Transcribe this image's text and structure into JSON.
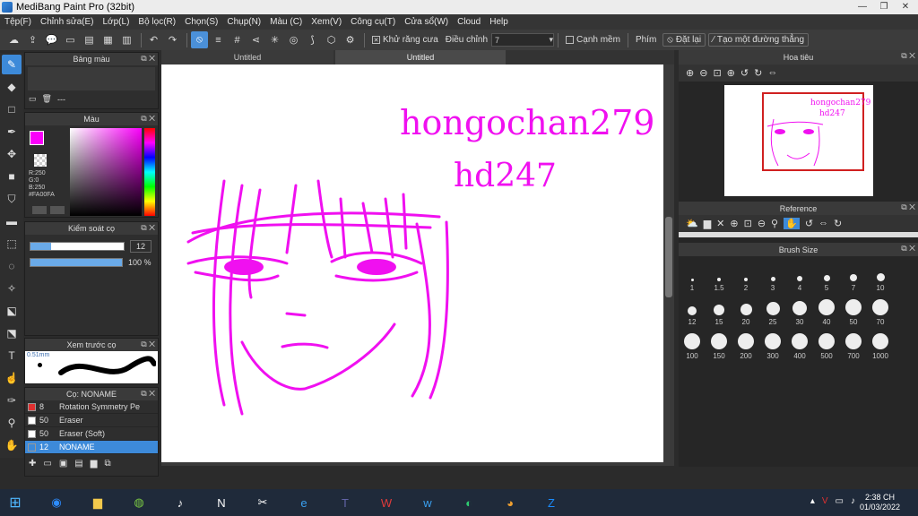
{
  "app": {
    "title": "MediBang Paint Pro (32bit)"
  },
  "menu": [
    "Tệp(F)",
    "Chỉnh sửa(E)",
    "Lớp(L)",
    "Bộ lọc(R)",
    "Chọn(S)",
    "Chụp(N)",
    "Màu (C)",
    "Xem(V)",
    "Công cụ(T)",
    "Cửa sổ(W)",
    "Cloud",
    "Help"
  ],
  "toolbar": {
    "antialias": "Khử răng cưa",
    "correction_label": "Điều chỉnh",
    "correction_value": "7",
    "edge": "Cạnh mềm",
    "key_label": "Phím",
    "reset": "Đặt lại",
    "straight": "Tạo một đường thẳng"
  },
  "tabs": [
    "Untitled",
    "Untitled"
  ],
  "panels": {
    "palette": "Bảng màu",
    "palette_value": "---",
    "color": "Màu",
    "brush_ctrl": "Kiểm soát cọ",
    "size_value": "12",
    "opacity_value": "100 %",
    "preview": "Xem trước cọ",
    "preview_size": "0.51mm",
    "brush": "Cọ: NONAME",
    "navigator": "Hoa tiêu",
    "reference": "Reference",
    "brush_size": "Brush Size"
  },
  "color": {
    "r": "R:250",
    "g": "G:0",
    "b": "B:250",
    "hex": "#FA00FA",
    "current": "#FA00FA"
  },
  "brushes": [
    {
      "num": "8",
      "name": "Rotation Symmetry Pen",
      "color": "#e03030"
    },
    {
      "num": "50",
      "name": "Eraser",
      "color": "#ffffff"
    },
    {
      "num": "50",
      "name": "Eraser (Soft)",
      "color": "#ffffff"
    },
    {
      "num": "12",
      "name": "NONAME",
      "color": "#3d8ad9"
    }
  ],
  "brush_sizes": [
    "1",
    "1.5",
    "2",
    "3",
    "4",
    "5",
    "7",
    "10",
    "12",
    "15",
    "20",
    "25",
    "30",
    "40",
    "50",
    "70",
    "100",
    "150",
    "200",
    "300",
    "400",
    "500",
    "700",
    "1000"
  ],
  "canvas_text": [
    "hongochan279",
    "hd247"
  ],
  "taskbar": {
    "time": "2:38 CH",
    "date": "01/03/2022"
  }
}
